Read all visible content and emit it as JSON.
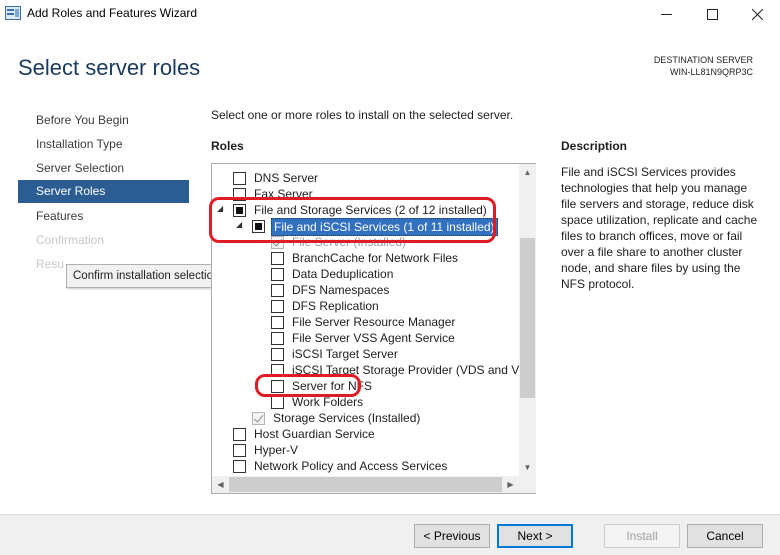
{
  "window": {
    "title": "Add Roles and Features Wizard",
    "minimize_icon": "minimize-icon",
    "maximize_icon": "maximize-icon",
    "close_icon": "close-icon"
  },
  "header": {
    "page_title": "Select server roles",
    "destination_label": "DESTINATION SERVER",
    "destination_server": "WIN-LL81N9QRP3C"
  },
  "nav": {
    "items": [
      {
        "label": "Before You Begin",
        "state": "normal"
      },
      {
        "label": "Installation Type",
        "state": "normal"
      },
      {
        "label": "Server Selection",
        "state": "normal"
      },
      {
        "label": "Server Roles",
        "state": "active"
      },
      {
        "label": "Features",
        "state": "normal"
      },
      {
        "label": "Confirmation",
        "state": "disabled"
      },
      {
        "label": "Resu",
        "state": "disabled"
      }
    ],
    "tooltip": "Confirm installation selections"
  },
  "main": {
    "instruction": "Select one or more roles to install on the selected server.",
    "roles_heading": "Roles",
    "roles": [
      {
        "label": "DNS Server",
        "state": "unchecked"
      },
      {
        "label": "Fax Server",
        "state": "unchecked"
      },
      {
        "label": "File and Storage Services (2 of 12 installed)",
        "state": "partial",
        "expander": "expanded"
      },
      {
        "label": "File and iSCSI Services (1 of 11 installed)",
        "state": "partial",
        "expander": "expanded",
        "selected": true
      },
      {
        "label": "File Server (Installed)",
        "state": "checked-disabled"
      },
      {
        "label": "BranchCache for Network Files",
        "state": "unchecked"
      },
      {
        "label": "Data Deduplication",
        "state": "unchecked"
      },
      {
        "label": "DFS Namespaces",
        "state": "unchecked"
      },
      {
        "label": "DFS Replication",
        "state": "unchecked"
      },
      {
        "label": "File Server Resource Manager",
        "state": "unchecked"
      },
      {
        "label": "File Server VSS Agent Service",
        "state": "unchecked"
      },
      {
        "label": "iSCSI Target Server",
        "state": "unchecked"
      },
      {
        "label": "iSCSI Target Storage Provider (VDS and VSS",
        "state": "unchecked"
      },
      {
        "label": "Server for NFS",
        "state": "unchecked"
      },
      {
        "label": "Work Folders",
        "state": "unchecked"
      },
      {
        "label": "Storage Services (Installed)",
        "state": "checked-disabled"
      },
      {
        "label": "Host Guardian Service",
        "state": "unchecked"
      },
      {
        "label": "Hyper-V",
        "state": "unchecked"
      },
      {
        "label": "Network Policy and Access Services",
        "state": "unchecked"
      }
    ],
    "description_heading": "Description",
    "description": "File and iSCSI Services provides technologies that help you manage file servers and storage, reduce disk space utilization, replicate and cache files to branch offices, move or fail over a file share to another cluster node, and share files by using the NFS protocol."
  },
  "footer": {
    "previous": "< Previous",
    "next": "Next >",
    "install": "Install",
    "cancel": "Cancel"
  },
  "colors": {
    "nav_active": "#2b5d92",
    "title_text": "#1a3a5e",
    "annotation_red": "#e01b24",
    "selection_blue": "#3270c0"
  }
}
